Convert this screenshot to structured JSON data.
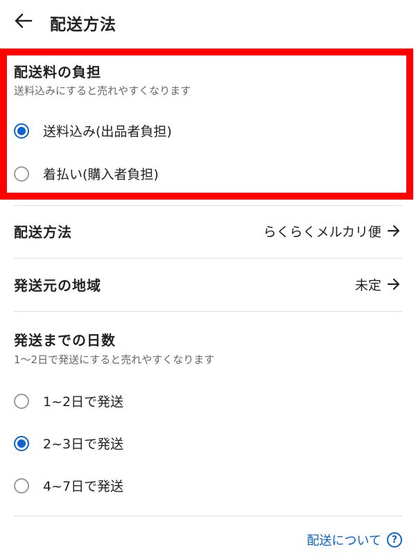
{
  "header": {
    "title": "配送方法"
  },
  "shipping_fee": {
    "title": "配送料の負担",
    "hint": "送料込みにすると売れやすくなります",
    "options": [
      {
        "label": "送料込み(出品者負担)",
        "selected": true
      },
      {
        "label": "着払い(購入者負担)",
        "selected": false
      }
    ]
  },
  "shipping_method": {
    "label": "配送方法",
    "value": "らくらくメルカリ便"
  },
  "origin_region": {
    "label": "発送元の地域",
    "value": "未定"
  },
  "days_to_ship": {
    "title": "発送までの日数",
    "hint": "1〜2日で発送にすると売れやすくなります",
    "options": [
      {
        "label": "1~2日で発送",
        "selected": false
      },
      {
        "label": "2~3日で発送",
        "selected": true
      },
      {
        "label": "4~7日で発送",
        "selected": false
      }
    ]
  },
  "footer": {
    "link_text": "配送について",
    "help_glyph": "?"
  },
  "colors": {
    "accent": "#0b63ce",
    "highlight": "#ff0000"
  }
}
